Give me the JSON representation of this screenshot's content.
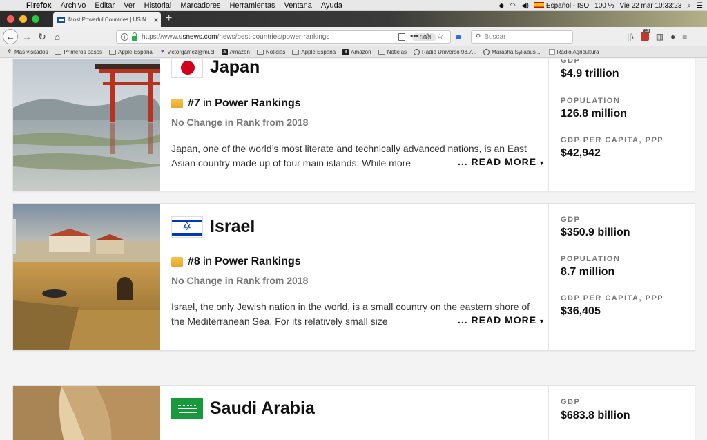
{
  "menubar": {
    "items": [
      "Firefox",
      "Archivo",
      "Editar",
      "Ver",
      "Historial",
      "Marcadores",
      "Herramientas",
      "Ventana",
      "Ayuda"
    ],
    "status": {
      "input_source": "Español - ISO",
      "battery": "100 %",
      "datetime": "Vie 22 mar  10:33:23"
    }
  },
  "browser": {
    "tab_title": "Most Powerful Countries | US N",
    "url_prefix": "https://www.",
    "url_host": "usnews.com",
    "url_path": "/news/best-countries/power-rankings",
    "zoom": "150%",
    "search_placeholder": "Buscar"
  },
  "bookmarks": [
    "Más visitados",
    "Primeros pasos",
    "Apple España",
    "victorgamez@mi.cl",
    "Amazon",
    "Noticias",
    "Apple España",
    "Amazon",
    "Noticias",
    "Radio Universo 93.7...",
    "Marasha Syllabus ...",
    "Radio Agricultura"
  ],
  "common": {
    "rank_in": "in",
    "rank_list": "Power Rankings",
    "read_more": "READ MORE",
    "gdp_label": "GDP",
    "population_label": "POPULATION",
    "gdp_pc_label": "GDP PER CAPITA, PPP"
  },
  "countries": [
    {
      "name": "Japan",
      "rank": "#7",
      "change": "No Change in Rank from 2018",
      "description": "Japan, one of the world’s most literate and technically advanced nations, is an East Asian country made up of four main islands. While more",
      "gdp": "$4.9 trillion",
      "population": "126.8 million",
      "gdp_per_capita": "$42,942"
    },
    {
      "name": "Israel",
      "rank": "#8",
      "change": "No Change in Rank from 2018",
      "description": "Israel, the only Jewish nation in the world, is a small country on the eastern shore of the Mediterranean Sea. For its relatively small size",
      "gdp": "$350.9 billion",
      "population": "8.7 million",
      "gdp_per_capita": "$36,405"
    },
    {
      "name": "Saudi Arabia",
      "gdp": "$683.8 billion"
    }
  ],
  "colors": {
    "japan_red": "#d3001b",
    "israel_blue": "#0038b8",
    "saudi_green": "#169a3c",
    "rank_gold": "#f2b73c"
  }
}
